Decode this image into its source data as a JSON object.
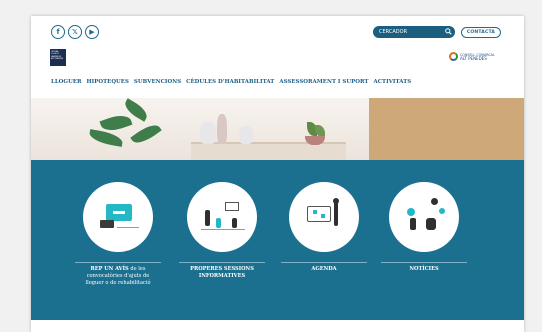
{
  "header": {
    "social": [
      {
        "name": "facebook",
        "glyph": "f"
      },
      {
        "name": "x",
        "glyph": "𝕏"
      },
      {
        "name": "youtube",
        "glyph": "▶"
      }
    ],
    "search_placeholder": "CERCADOR",
    "contact_label": "CONTACTA",
    "logo_lines": [
      "OFICINA",
      "LOCAL D'",
      "HABITATGE",
      "ALT PENEDÈS"
    ],
    "org_logo_lines": [
      "CONSELL COMARCAL",
      "ALT PENEDÈS"
    ]
  },
  "nav": {
    "items": [
      "LLOGUER",
      "HIPOTEQUES",
      "SUBVENCIONS",
      "CÈDULES D'HABITABILITAT",
      "ASSESSORAMENT I SUPORT",
      "ACTIVITATS"
    ]
  },
  "cards": [
    {
      "label_bold": "REP UN AVÍS",
      "label_rest": " de les convocatòries d'ajuts de lloguer o de rehabilitació"
    },
    {
      "label_bold": "PROPERES SESSIONS INFORMATIVES",
      "label_rest": ""
    },
    {
      "label_bold": "AGENDA",
      "label_rest": ""
    },
    {
      "label_bold": "NOTÍCIES",
      "label_rest": ""
    }
  ],
  "colors": {
    "brand_blue": "#1b6f8f",
    "nav_blue": "#1f5f85"
  },
  "icons": [
    "facebook-icon",
    "x-icon",
    "youtube-icon",
    "search-icon"
  ]
}
